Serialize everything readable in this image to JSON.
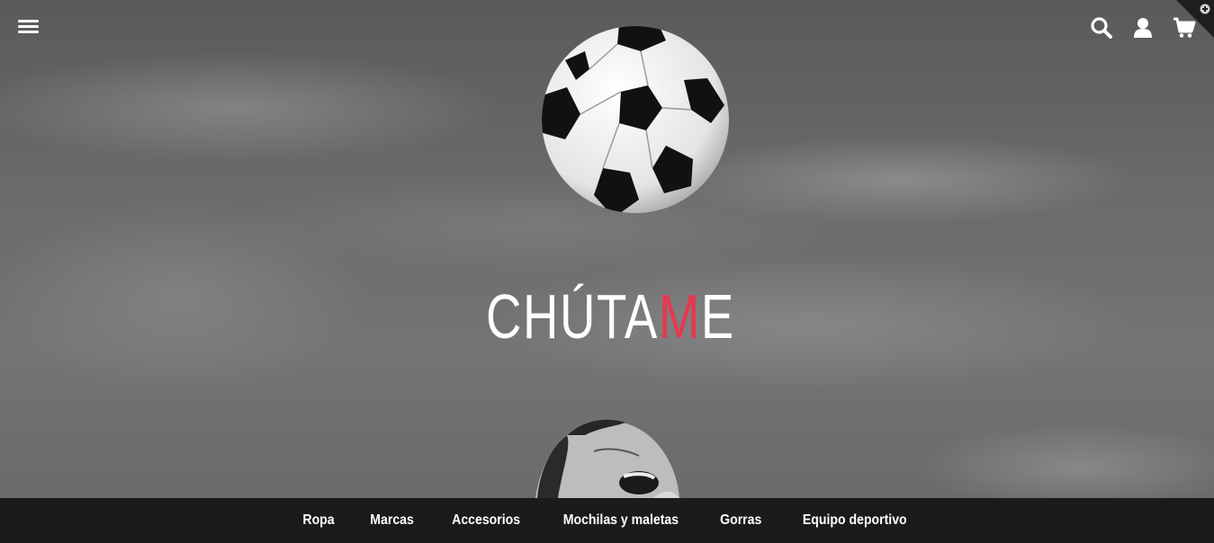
{
  "header": {
    "logo_main": "CHÚTA",
    "logo_accent": "M",
    "logo_end": "E",
    "icons": [
      "menu-icon",
      "search-icon",
      "user-icon",
      "cart-icon",
      "plus-icon"
    ]
  },
  "nav": {
    "items": [
      {
        "label": "Ropa"
      },
      {
        "label": "Marcas"
      },
      {
        "label": "Accesorios"
      },
      {
        "label": "Mochilas y maletas"
      },
      {
        "label": "Gorras"
      },
      {
        "label": "Equipo deportivo"
      }
    ]
  },
  "colors": {
    "accent": "#e8384f",
    "navbar_bg": "#1b1b1b"
  }
}
